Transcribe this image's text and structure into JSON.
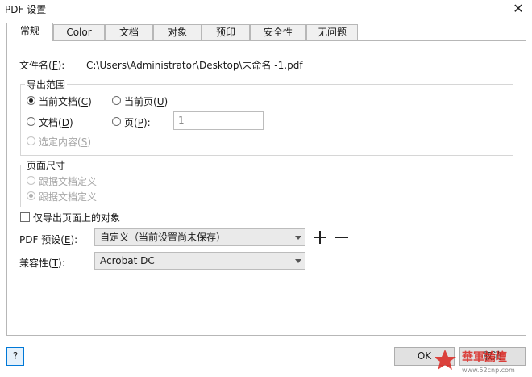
{
  "window": {
    "title": "PDF 设置",
    "close_glyph": "✕"
  },
  "tabs": [
    {
      "label": "常规",
      "active": true
    },
    {
      "label": "Color"
    },
    {
      "label": "文档"
    },
    {
      "label": "对象"
    },
    {
      "label": "预印"
    },
    {
      "label": "安全性"
    },
    {
      "label": "无问题"
    }
  ],
  "file": {
    "label": "文件名(F):",
    "label_main": "文件名(",
    "label_key": "F",
    "label_end": "):",
    "value": "C:\\Users\\Administrator\\Desktop\\未命名 -1.pdf"
  },
  "export_range": {
    "title": "导出范围",
    "current_doc": {
      "main": "当前文档(",
      "key": "C",
      "end": ")"
    },
    "current_page": {
      "main": "当前页(",
      "key": "U",
      "end": ")"
    },
    "documents": {
      "main": "文档(",
      "key": "D",
      "end": ")"
    },
    "pages": {
      "main": "页(",
      "key": "P",
      "end": "):"
    },
    "pages_value": "1",
    "selection": {
      "main": "选定内容(",
      "key": "S",
      "end": ")"
    }
  },
  "page_size": {
    "title": "页面尺寸",
    "opt1": "跟据文档定义",
    "opt2": "跟据文档定义"
  },
  "only_objects": {
    "label": "仅导出页面上的对象"
  },
  "pdf_preset": {
    "main": "PDF 预设(",
    "key": "E",
    "end": "):",
    "value": "自定义（当前设置尚未保存）",
    "add_glyph": "+",
    "remove_glyph": "−"
  },
  "compat": {
    "main": "兼容性(",
    "key": "T",
    "end": "):",
    "value": "Acrobat DC"
  },
  "footer": {
    "help": "?",
    "ok": "OK",
    "cancel": "取消"
  },
  "watermark": {
    "text": "華軍論壇",
    "url": "www.52cnp.com"
  },
  "colors": {
    "accent": "#0078d7",
    "watermark_red": "#d9241f"
  }
}
